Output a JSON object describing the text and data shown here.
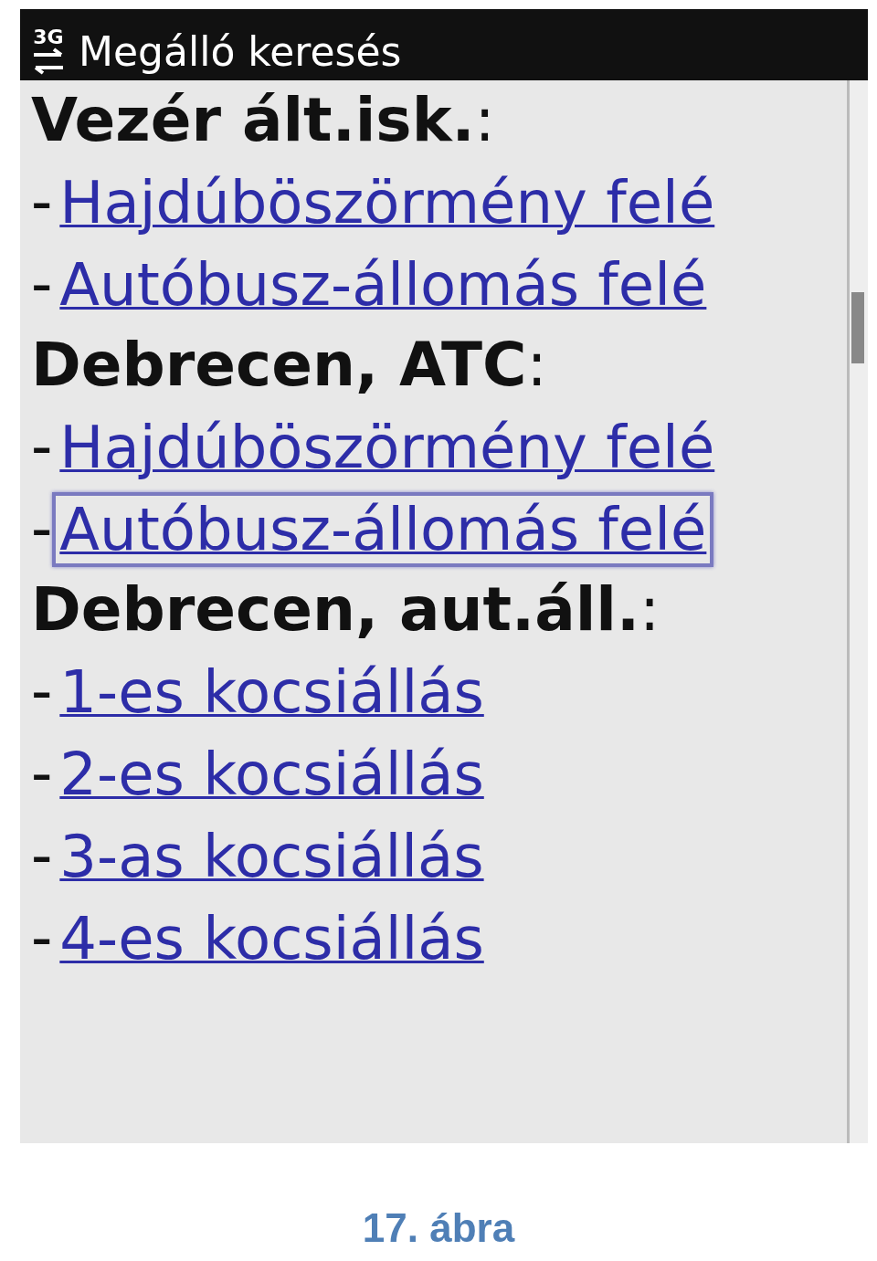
{
  "status_bar": {
    "network": "3G",
    "title": "Megálló keresés"
  },
  "stops": [
    {
      "name": "**Vezér ált.isk.**:",
      "links": [
        {
          "dash": "-",
          "label": "Hajdúböszörmény felé",
          "focused": false
        },
        {
          "dash": "-",
          "label": "Autóbusz-állomás felé",
          "focused": false
        }
      ]
    },
    {
      "name": "**Debrecen, ATC**:",
      "links": [
        {
          "dash": "-",
          "label": "Hajdúböszörmény felé",
          "focused": false
        },
        {
          "dash": "-",
          "label": "Autóbusz-állomás felé",
          "focused": true
        }
      ]
    },
    {
      "name": "**Debrecen, aut.áll.**:",
      "links": [
        {
          "dash": "-",
          "label": "1-es kocsiállás",
          "focused": false
        },
        {
          "dash": "-",
          "label": "2-es kocsiállás",
          "focused": false
        },
        {
          "dash": "-",
          "label": "3-as kocsiállás",
          "focused": false
        },
        {
          "dash": "-",
          "label": "4-es kocsiállás",
          "focused": false
        }
      ]
    }
  ],
  "caption": "17. ábra"
}
